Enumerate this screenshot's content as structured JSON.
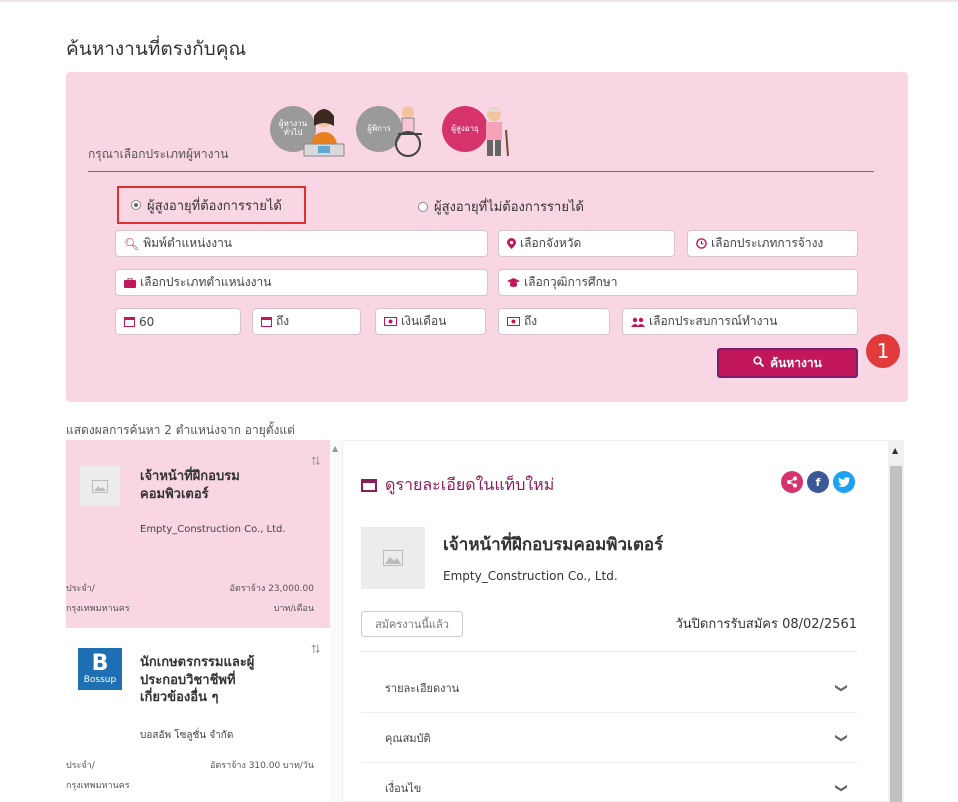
{
  "page": {
    "title": "ค้นหางานที่ตรงกับคุณ"
  },
  "search": {
    "seeker_label": "กรุณาเลือกประเภทผู้หางาน",
    "seeker_types": [
      {
        "label": "ผู้หางาน ทั่วไป",
        "active": false
      },
      {
        "label": "ผู้พิการ",
        "active": false
      },
      {
        "label": "ผู้สูงอายุ",
        "active": true
      }
    ],
    "radio_income": "ผู้สูงอายุที่ต้องการรายได้",
    "radio_no_income": "ผู้สูงอายุที่ไม่ต้องการรายได้",
    "position_placeholder": "พิมพ์ตำแหน่งงาน",
    "province_placeholder": "เลือกจังหวัด",
    "employment_type_placeholder": "เลือกประเภทการจ้างง",
    "position_type_placeholder": "เลือกประเภทตำแหน่งงาน",
    "education_placeholder": "เลือกวุฒิการศึกษา",
    "age_from_value": "60",
    "age_to_placeholder": "ถึง",
    "salary_from_placeholder": "เงินเดือน",
    "salary_to_placeholder": "ถึง",
    "experience_placeholder": "เลือกประสบการณ์ทำงาน",
    "search_button": "ค้นหางาน",
    "step_badge": "1",
    "accent_color": "#c2185b",
    "panel_color": "#f9d6e4"
  },
  "results": {
    "summary": "แสดงผลการค้นหา 2 ตำแหน่งจาก อายุตั้งแต่",
    "jobs": [
      {
        "title": "เจ้าหน้าที่ฝึกอบรม คอมพิวเตอร์",
        "company": "Empty_Construction Co., Ltd.",
        "job_type": "ประจำ/",
        "location": "กรุงเทพมหานคร",
        "wage": "อัตราจ้าง 23,000.00",
        "wage_unit": "บาท/เดือน",
        "active": true
      },
      {
        "title": "นักเกษตรกรรมและผู้ ประกอบวิชาชีพที่ เกี่ยวข้องอื่น ๆ",
        "company": "บอสอัพ โซลูชั่น จำกัด",
        "job_type": "ประจำ/",
        "location": "กรุงเทพมหานคร",
        "wage": "อัตราจ้าง 310.00 บาท/วัน",
        "logo_text": "Bossup",
        "active": false
      }
    ]
  },
  "detail": {
    "open_new_tab": "ดูรายละเอียดในแท็บใหม่",
    "title": "เจ้าหน้าที่ฝึกอบรมคอมพิวเตอร์",
    "company": "Empty_Construction Co., Ltd.",
    "applied_button": "สมัครงานนี้แล้ว",
    "close_date": "วันปิดการรับสมัคร 08/02/2561",
    "sections": [
      "รายละเอียดงาน",
      "คุณสมบัติ",
      "เงื่อนไข"
    ],
    "share_colors": {
      "share": "#d6336c",
      "facebook": "#3b5998",
      "twitter": "#1da1f2"
    }
  }
}
